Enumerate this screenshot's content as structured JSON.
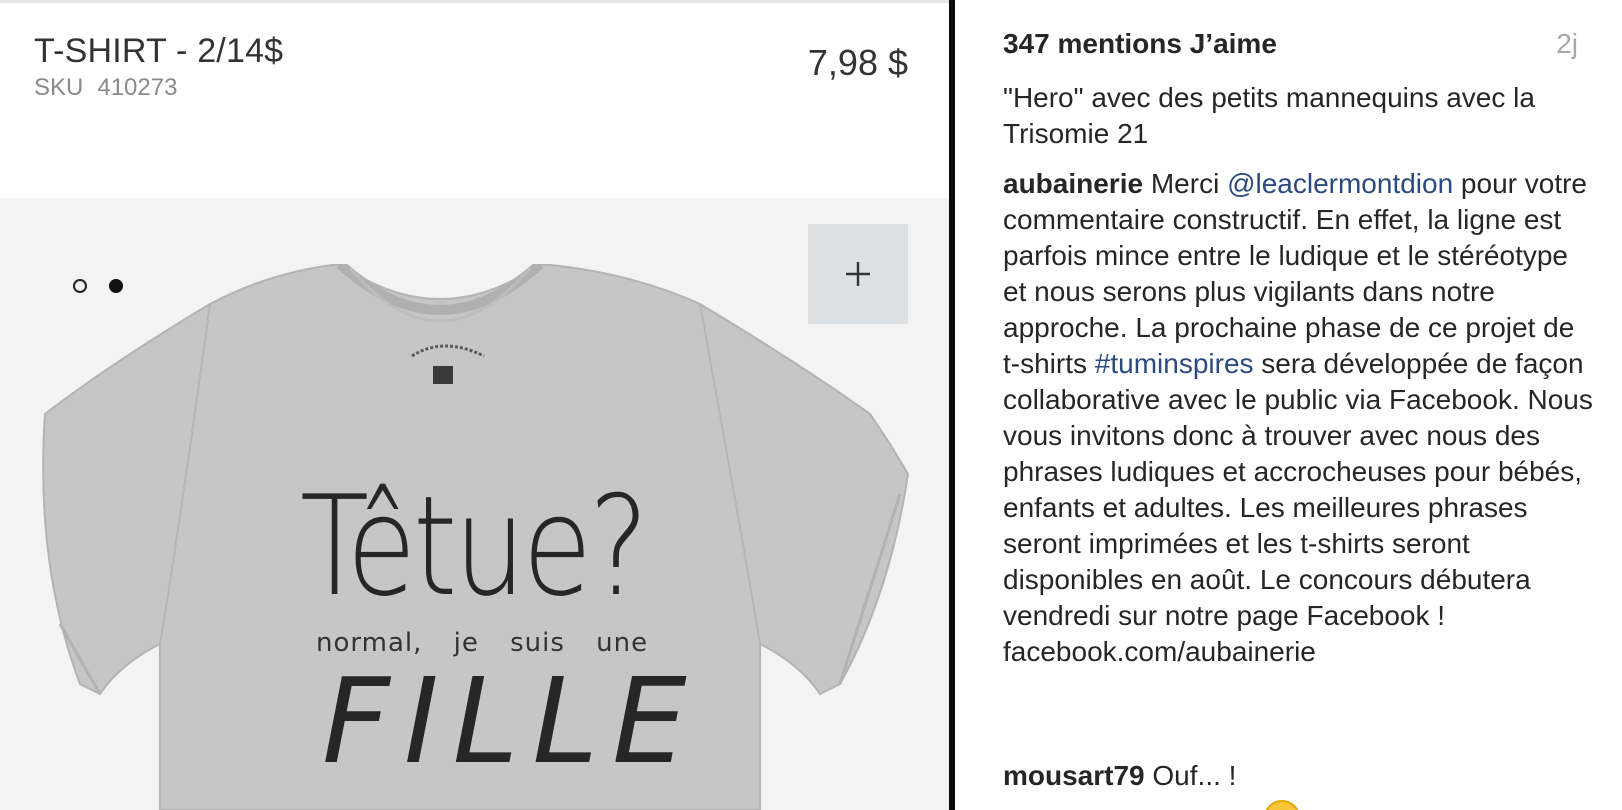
{
  "product": {
    "title": "T-SHIRT - 2/14$",
    "sku_label": "SKU",
    "sku_value": "410273",
    "price": "7,98 $",
    "carousel": {
      "count": 2,
      "active_index": 1
    },
    "zoom_icon": "plus-icon",
    "shirt": {
      "color": "#c6c6c6",
      "print_main": "Têtue?",
      "print_tagline": "normal, je suis une",
      "print_bottom": "FILLE"
    }
  },
  "post": {
    "likes": "347 mentions J’aime",
    "time_ago": "2j",
    "caption_tail": "\"Hero\" avec des petits mannequins avec la Trisomie 21",
    "comments": [
      {
        "user": "aubainerie",
        "text_1": " Merci ",
        "mention": "@leaclermontdion",
        "text_2": " pour votre commentaire constructif. En effet, la ligne est parfois mince entre le ludique et le stéréotype et nous serons plus vigilants dans notre approche. La prochaine phase de ce projet de t-shirts ",
        "hashtag": "#tuminspires",
        "text_3": " sera développée de façon collaborative avec le public via Facebook. Nous vous invitons donc à trouver avec nous des phrases ludiques et accrocheuses pour bébés, enfants et adultes. Les meilleures phrases seront imprimées et les t-shirts seront disponibles en août. Le concours débutera vendredi sur notre page Facebook ! facebook.com/aubainerie"
      },
      {
        "user": "mousart79",
        "text_1": " Ouf... !"
      }
    ]
  },
  "colors": {
    "link": "#2b4a7e",
    "muted": "#a8a8a8",
    "divider": "#0a0a0a",
    "image_bg": "#f3f3f3",
    "zoom_bg": "#dde1e3"
  }
}
